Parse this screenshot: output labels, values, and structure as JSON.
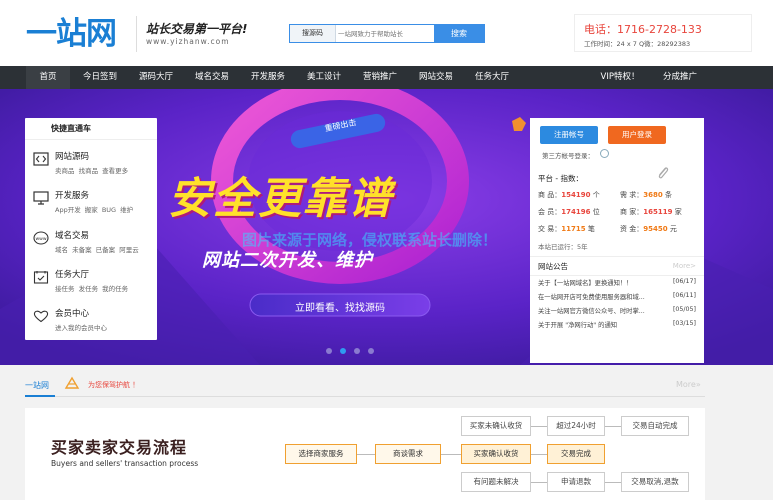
{
  "header": {
    "logo_text": "一站网",
    "slogan": "站长交易第一平台!",
    "slogan_url": "www.yizhanw.com",
    "search": {
      "category": "搜源码",
      "placeholder": "一站网致力于帮助站长",
      "button": "搜索"
    },
    "contact": {
      "phone": "电话：1716-2728-133",
      "hours": "工作时间：24 x 7 Q微：28292383"
    }
  },
  "nav": {
    "items": [
      "首页",
      "今日签到",
      "源码大厅",
      "域名交易",
      "开发服务",
      "美工设计",
      "营销推广",
      "网站交易",
      "任务大厅"
    ],
    "right_items": [
      "VIP特权！",
      "分成推广"
    ],
    "active_index": 0
  },
  "banner": {
    "headline": "安全更靠谱",
    "subhead": "网站二次开发、维护",
    "cta": "立即看看、找找源码",
    "ring_text": "重磅出击",
    "watermark": "图片来源于网络，侵权联系站长删除！",
    "slide_count": 4,
    "active_slide": 1
  },
  "quick_nav": {
    "title": "快捷直通车",
    "items": [
      {
        "name": "网站源码",
        "sub": "卖商品 找商品 查看更多",
        "icon": "code-icon"
      },
      {
        "name": "开发服务",
        "sub": "App开发 搬家 BUG 维护",
        "icon": "monitor-icon"
      },
      {
        "name": "域名交易",
        "sub": "域名 未备案 已备案 阿里云",
        "icon": "www-icon"
      },
      {
        "name": "任务大厅",
        "sub": "接任务 发任务 我的任务",
        "icon": "calendar-check-icon"
      },
      {
        "name": "会员中心",
        "sub": "进入我的会员中心",
        "icon": "heart-icon"
      }
    ]
  },
  "login_panel": {
    "register": "注册帐号",
    "login": "用户登录",
    "third_party": "第三方帐号登录：",
    "stats_title": "平台 - 指数：",
    "stats": [
      {
        "label": "商 品：",
        "value": "154190",
        "unit": "个"
      },
      {
        "label": "需 求：",
        "value": "3680",
        "unit": "条"
      },
      {
        "label": "会 员：",
        "value": "174196",
        "unit": "位"
      },
      {
        "label": "商 家：",
        "value": "165119",
        "unit": "家"
      },
      {
        "label": "交 易：",
        "value": "11715",
        "unit": "笔"
      },
      {
        "label": "资 金：",
        "value": "95450",
        "unit": "元"
      }
    ],
    "stats_footer": "本站已运行：5年",
    "notice": {
      "title": "网站公告",
      "more": "More>",
      "items": [
        {
          "text": "关于【一站网域名】更换通知！！",
          "date": "[06/17]"
        },
        {
          "text": "在一站网开店可免费使用服务器和域...",
          "date": "[06/11]"
        },
        {
          "text": "关注一站网官方微信公众号、时时掌...",
          "date": "[05/05]"
        },
        {
          "text": "关于开展 \"净网行动\" 的通知",
          "date": "[03/15]"
        }
      ]
    }
  },
  "section": {
    "brand": "一站网",
    "tag": "为您保驾护航 ！",
    "more": "More»"
  },
  "flow": {
    "title": "买家卖家交易流程",
    "subtitle": "Buyers and sellers' transaction process",
    "steps": {
      "choose": "选择商家服务",
      "negotiate": "商谈需求",
      "buyer_confirm": "买家确认收货",
      "trade_done": "交易完成",
      "unconfirmed": "买家未确认收货",
      "over24": "超过24小时",
      "auto_done": "交易自动完成",
      "problem": "有问题未解决",
      "refund_apply": "申请退款",
      "refunded": "交易取消,退款"
    }
  },
  "colors": {
    "brand_blue": "#1a7fd4",
    "nav_bg": "#2c3136",
    "banner_purple": "#5a23c7",
    "accent_red": "#e8453c",
    "accent_orange": "#f0681f"
  }
}
